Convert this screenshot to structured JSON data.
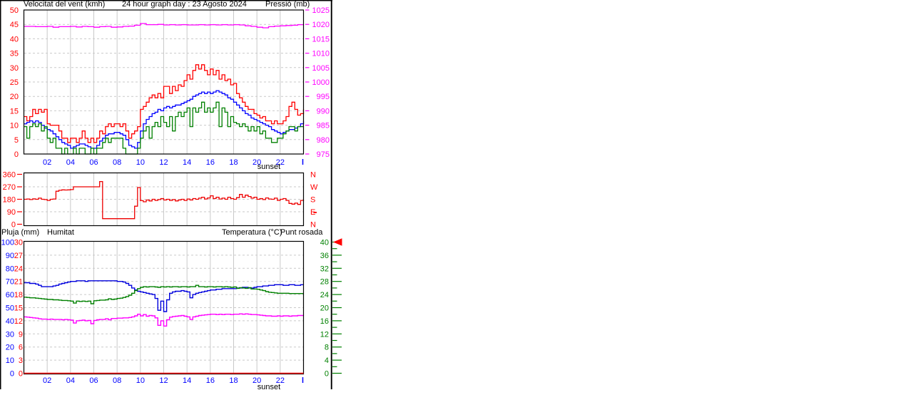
{
  "header": {
    "left_label": "Velocitat del vent (kmh)",
    "title": "24 hour graph day : 23 Agosto 2024",
    "right_label": "Pressió (mb)"
  },
  "panel3_header": {
    "rain_label": "Pluja (mm)",
    "humidity_label": "Humitat",
    "temperature_label": "Temperatura (°C)",
    "dewpoint_label": "Punt rosada"
  },
  "x_axis": {
    "hour_labels": [
      "02",
      "04",
      "06",
      "08",
      "10",
      "12",
      "14",
      "16",
      "18",
      "20",
      "22"
    ],
    "sunset_label": "sunset",
    "sunset_hour": 20.9
  },
  "colors": {
    "red": "#ff0000",
    "blue": "#0000ff",
    "navy": "#000080",
    "green": "#008000",
    "magenta": "#ff00ff",
    "grid": "#c9c9c9",
    "frame": "#000000",
    "humidity_line": "#0000dd",
    "direction_line": "#ee0000"
  },
  "chart_data": [
    {
      "type": "line",
      "name": "wind-speed-and-pressure",
      "x_range_hours": [
        0,
        24
      ],
      "left_axis": {
        "label": "Velocitat del vent (kmh)",
        "range": [
          0,
          50
        ],
        "tick_step": 5,
        "color": "red"
      },
      "right_axis": {
        "label": "Pressió (mb)",
        "range": [
          975,
          1025
        ],
        "tick_step": 5,
        "color": "magenta"
      },
      "grid": true,
      "series": [
        {
          "name": "wind-gust",
          "color": "red",
          "axis": "left",
          "dt_hours": 0.25,
          "values": [
            13,
            11.5,
            13,
            15.5,
            14,
            15.5,
            14.5,
            15.5,
            10.5,
            10,
            10,
            10,
            8,
            5.5,
            5.5,
            4,
            5.5,
            5.5,
            4,
            5.5,
            8,
            5.5,
            4,
            5.5,
            4,
            5.5,
            8,
            7,
            9.5,
            10.5,
            9.5,
            10.5,
            10.5,
            9.5,
            10.5,
            8,
            5.5,
            7,
            8,
            9.5,
            15.5,
            16.5,
            18,
            19.5,
            20.5,
            19.5,
            21,
            19.5,
            23.5,
            23.5,
            21,
            23.5,
            22,
            24,
            23.5,
            25.5,
            27.5,
            26,
            29,
            31,
            29.5,
            31,
            29,
            27.5,
            29.5,
            27.5,
            29,
            26,
            27.5,
            25.5,
            26,
            24,
            24.5,
            21,
            19.5,
            18,
            16.5,
            15.5,
            15.5,
            14,
            13.5,
            12.5,
            13,
            11.5,
            11.5,
            10.5,
            11.5,
            10.5,
            10.5,
            11.5,
            13,
            16.5,
            18,
            15.5,
            13.5,
            14,
            15.5
          ]
        },
        {
          "name": "wind-average",
          "color": "blue",
          "axis": "left",
          "dt_hours": 0.25,
          "values": [
            10.5,
            11,
            11.5,
            11,
            11.5,
            11,
            10,
            9,
            8.5,
            8,
            7,
            6,
            5,
            4,
            3.5,
            3,
            2,
            2.5,
            3,
            3.5,
            3.5,
            3,
            2.5,
            2,
            2,
            3,
            4.5,
            5.5,
            6.5,
            7,
            7,
            7.5,
            7.5,
            7,
            6.5,
            5,
            3,
            2.5,
            2,
            4,
            8,
            10.5,
            12,
            13,
            14,
            14.5,
            15.5,
            15,
            16,
            16.5,
            16,
            16.5,
            17,
            17,
            17.5,
            18,
            18.5,
            19,
            20,
            20.5,
            21,
            21.5,
            21,
            21.5,
            21,
            21.5,
            22,
            21.5,
            21,
            20.5,
            19.5,
            19,
            18,
            17,
            16,
            15,
            14,
            13.5,
            12.5,
            12,
            11.5,
            11,
            10.5,
            10,
            9.5,
            8.5,
            8,
            7.5,
            7,
            7.5,
            8,
            8.5,
            8.5,
            9,
            9.5,
            10.5,
            11.5
          ]
        },
        {
          "name": "wind-lull",
          "color": "green",
          "axis": "left",
          "dt_hours": 0.25,
          "values": [
            9.5,
            5.5,
            9.5,
            10.5,
            9.5,
            10.5,
            8,
            9.5,
            5.5,
            4,
            5.5,
            2,
            2,
            0,
            2,
            0,
            0,
            2,
            0,
            2,
            2,
            0,
            0,
            2,
            0,
            2,
            2,
            4,
            5.5,
            4,
            5.5,
            5.5,
            5.5,
            5.5,
            2,
            0,
            0,
            0,
            0,
            2,
            5.5,
            8,
            9.5,
            5.5,
            9.5,
            11,
            9.5,
            13,
            11,
            9.5,
            13,
            8,
            13,
            14.5,
            13,
            14.5,
            16,
            9.5,
            16,
            14.5,
            16,
            18,
            14.5,
            16,
            14.5,
            16,
            18,
            9.5,
            16,
            14.5,
            9.5,
            13,
            11,
            10.5,
            9.5,
            10.5,
            9.5,
            8,
            9.5,
            8,
            9.5,
            7,
            8,
            5.5,
            5.5,
            4,
            4,
            5.5,
            5.5,
            7,
            8,
            9.5,
            9.5,
            8,
            9.5,
            9.5,
            9.5
          ]
        },
        {
          "name": "pressure",
          "color": "magenta",
          "axis": "right",
          "dt_hours": 0.5,
          "values": [
            1019.3,
            1019.3,
            1019.2,
            1019.2,
            1019.3,
            1019.0,
            1019.2,
            1019.2,
            1019.3,
            1019.1,
            1019.3,
            1019.2,
            1019.0,
            1019.2,
            1019.3,
            1019.0,
            1019.1,
            1019.3,
            1019.4,
            1019.7,
            1020.3,
            1019.9,
            1019.9,
            1020.0,
            1019.8,
            1019.9,
            1019.8,
            1019.9,
            1019.8,
            1019.8,
            1019.9,
            1019.8,
            1019.9,
            1019.8,
            1019.9,
            1019.8,
            1019.9,
            1019.8,
            1019.5,
            1019.3,
            1019.0,
            1018.8,
            1019.2,
            1019.4,
            1019.5,
            1019.6,
            1019.7,
            1019.9,
            1020.0
          ]
        }
      ]
    },
    {
      "type": "line",
      "name": "wind-direction",
      "x_range_hours": [
        0,
        24
      ],
      "left_axis": {
        "range": [
          0,
          360
        ],
        "ticks": [
          0,
          90,
          180,
          270,
          360
        ],
        "color": "red"
      },
      "right_axis": {
        "labels_top_to_bottom": [
          "N",
          "W",
          "S",
          "E",
          "N"
        ],
        "color": "red"
      },
      "series": [
        {
          "name": "wind-direction",
          "color": "direction_line",
          "axis": "left",
          "dt_hours": 0.25,
          "values": [
            180,
            182,
            178,
            183,
            180,
            188,
            180,
            178,
            172,
            180,
            182,
            238,
            245,
            248,
            247,
            248,
            250,
            270,
            270,
            270,
            270,
            270,
            270,
            270,
            270,
            270,
            308,
            40,
            40,
            40,
            40,
            40,
            40,
            40,
            40,
            40,
            40,
            40,
            130,
            265,
            170,
            162,
            175,
            168,
            180,
            172,
            178,
            185,
            175,
            180,
            172,
            178,
            168,
            175,
            180,
            172,
            182,
            175,
            185,
            180,
            188,
            195,
            182,
            190,
            205,
            185,
            195,
            182,
            188,
            180,
            195,
            185,
            180,
            192,
            215,
            195,
            210,
            200,
            188,
            195,
            180,
            185,
            178,
            190,
            182,
            180,
            188,
            172,
            180,
            185,
            172,
            150,
            145,
            152,
            143,
            172,
            168
          ]
        }
      ]
    },
    {
      "type": "line",
      "name": "rain-humidity-temperature-dewpoint",
      "x_range_hours": [
        0,
        24
      ],
      "axes": {
        "humidity": {
          "label": "Humitat",
          "range": [
            0,
            100
          ],
          "tick_step": 10,
          "color": "blue",
          "side": "left"
        },
        "rain": {
          "label": "Pluja (mm)",
          "range": [
            0,
            30
          ],
          "tick_step": 3,
          "color": "red",
          "side": "left"
        },
        "temperature": {
          "label": "Temperatura (°C)",
          "range": [
            0,
            40
          ],
          "tick_step": 4,
          "minor_tick_step": 2,
          "color": "green",
          "side": "right"
        }
      },
      "series": [
        {
          "name": "humidity",
          "color": "humidity_line",
          "axis": "humidity",
          "dt_hours": 0.25,
          "values": [
            69,
            69,
            68.5,
            68.5,
            68,
            67,
            66,
            66,
            66,
            66,
            66.5,
            67,
            68,
            68.5,
            69,
            69.5,
            70,
            70,
            70.5,
            70.5,
            70.5,
            70,
            70.5,
            70.5,
            70.5,
            70.5,
            70.5,
            70.5,
            70.5,
            70.5,
            70.5,
            70.5,
            70,
            70,
            69.5,
            68.5,
            67,
            65,
            63.5,
            62.5,
            62,
            61.5,
            61,
            60.5,
            60,
            57,
            48,
            55,
            47,
            56,
            61,
            62,
            62.5,
            62.5,
            63,
            62.5,
            62,
            57.5,
            60,
            61,
            61.5,
            62,
            62.5,
            63,
            63.5,
            63.5,
            64,
            64,
            64.5,
            64.5,
            64.5,
            64.5,
            64.5,
            65,
            65,
            65.5,
            65.5,
            65,
            65,
            65.5,
            66,
            66,
            66.5,
            66.5,
            67,
            67,
            67.5,
            67.5,
            67.5,
            67,
            67,
            67.5,
            67.5,
            67,
            67,
            67.5,
            67.5
          ]
        },
        {
          "name": "temperature",
          "color": "green",
          "axis": "temperature",
          "dt_hours": 0.25,
          "values": [
            23.2,
            23.1,
            23.0,
            23.0,
            22.9,
            22.8,
            22.7,
            22.6,
            22.5,
            22.5,
            22.4,
            22.4,
            22.3,
            22.2,
            22.2,
            22.1,
            22.0,
            21.4,
            22.0,
            21.9,
            22.0,
            21.9,
            22.0,
            21.2,
            22.1,
            22.2,
            22.3,
            22.3,
            22.4,
            22.7,
            22.5,
            22.6,
            22.8,
            22.9,
            23.1,
            23.4,
            23.8,
            24.4,
            25.2,
            25.8,
            26.2,
            26.4,
            26.3,
            26.4,
            26.4,
            26.3,
            26.2,
            26.4,
            26.3,
            26.4,
            26.3,
            26.4,
            26.4,
            26.3,
            26.4,
            26.4,
            26.3,
            26.4,
            26.4,
            26.8,
            26.4,
            26.4,
            26.3,
            26.4,
            26.4,
            26.3,
            26.4,
            26.4,
            26.3,
            26.4,
            26.3,
            26.2,
            26.3,
            25.9,
            26.1,
            26.0,
            25.9,
            26.1,
            25.7,
            25.7,
            25.6,
            25.4,
            25.2,
            24.9,
            24.7,
            24.6,
            24.5,
            24.4,
            24.4,
            24.4,
            24.4,
            24.3,
            24.3,
            24.3,
            24.3,
            24.3,
            24.3
          ]
        },
        {
          "name": "dew-point",
          "color": "magenta",
          "axis": "temperature",
          "dt_hours": 0.25,
          "values": [
            17.2,
            17.1,
            17.0,
            16.9,
            16.8,
            16.6,
            16.5,
            16.5,
            16.4,
            16.5,
            16.4,
            16.4,
            16.4,
            16.3,
            16.4,
            16.3,
            16.2,
            15.3,
            16.0,
            16.1,
            16.2,
            16.0,
            16.1,
            15.1,
            16.1,
            16.3,
            16.4,
            16.4,
            16.6,
            16.3,
            16.7,
            16.7,
            16.8,
            16.8,
            16.9,
            16.9,
            17.0,
            17.2,
            17.5,
            18.0,
            17.5,
            17.9,
            17.4,
            17.6,
            17.5,
            16.9,
            14.6,
            16.0,
            14.4,
            16.3,
            17.1,
            17.3,
            17.4,
            17.5,
            17.6,
            17.4,
            17.2,
            16.4,
            17.2,
            17.4,
            17.6,
            17.7,
            17.8,
            17.9,
            18.0,
            18.0,
            17.9,
            18.0,
            17.9,
            18.0,
            18.0,
            17.9,
            18.0,
            18.0,
            18.1,
            18.0,
            18.1,
            18.0,
            17.9,
            17.9,
            17.8,
            17.7,
            17.6,
            17.5,
            17.5,
            17.4,
            17.4,
            17.5,
            17.4,
            17.5,
            17.5,
            17.4,
            17.5,
            17.5,
            17.6,
            17.6,
            17.6
          ]
        },
        {
          "name": "rain",
          "color": "red",
          "axis": "rain",
          "dt_hours": 24,
          "values": [
            0,
            0
          ]
        }
      ],
      "marker": {
        "name": "red-arrow",
        "at_value": 40,
        "axis": "temperature"
      }
    }
  ]
}
